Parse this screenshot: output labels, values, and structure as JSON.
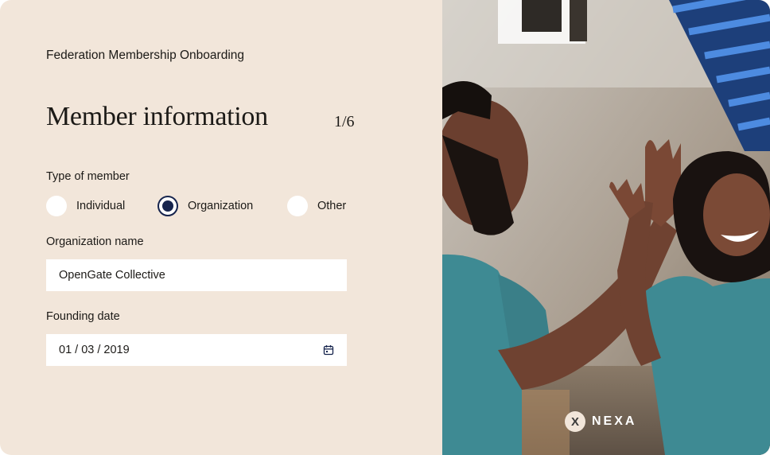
{
  "header": {
    "app_title": "Federation Membership Onboarding"
  },
  "page": {
    "title": "Member information",
    "step": "1/6"
  },
  "member_type": {
    "label": "Type of member",
    "options": [
      {
        "label": "Individual",
        "checked": false
      },
      {
        "label": "Organization",
        "checked": true
      },
      {
        "label": "Other",
        "checked": false
      }
    ]
  },
  "organization_name": {
    "label": "Organization name",
    "value": "OpenGate Collective"
  },
  "founding_date": {
    "label": "Founding date",
    "value": "01 / 03 / 2019",
    "icon": "calendar-icon"
  },
  "brand": {
    "mark": "X",
    "name": "NEXA"
  },
  "colors": {
    "panel_bg": "#f2e6da",
    "accent": "#16244d",
    "text": "#1c1a17"
  }
}
